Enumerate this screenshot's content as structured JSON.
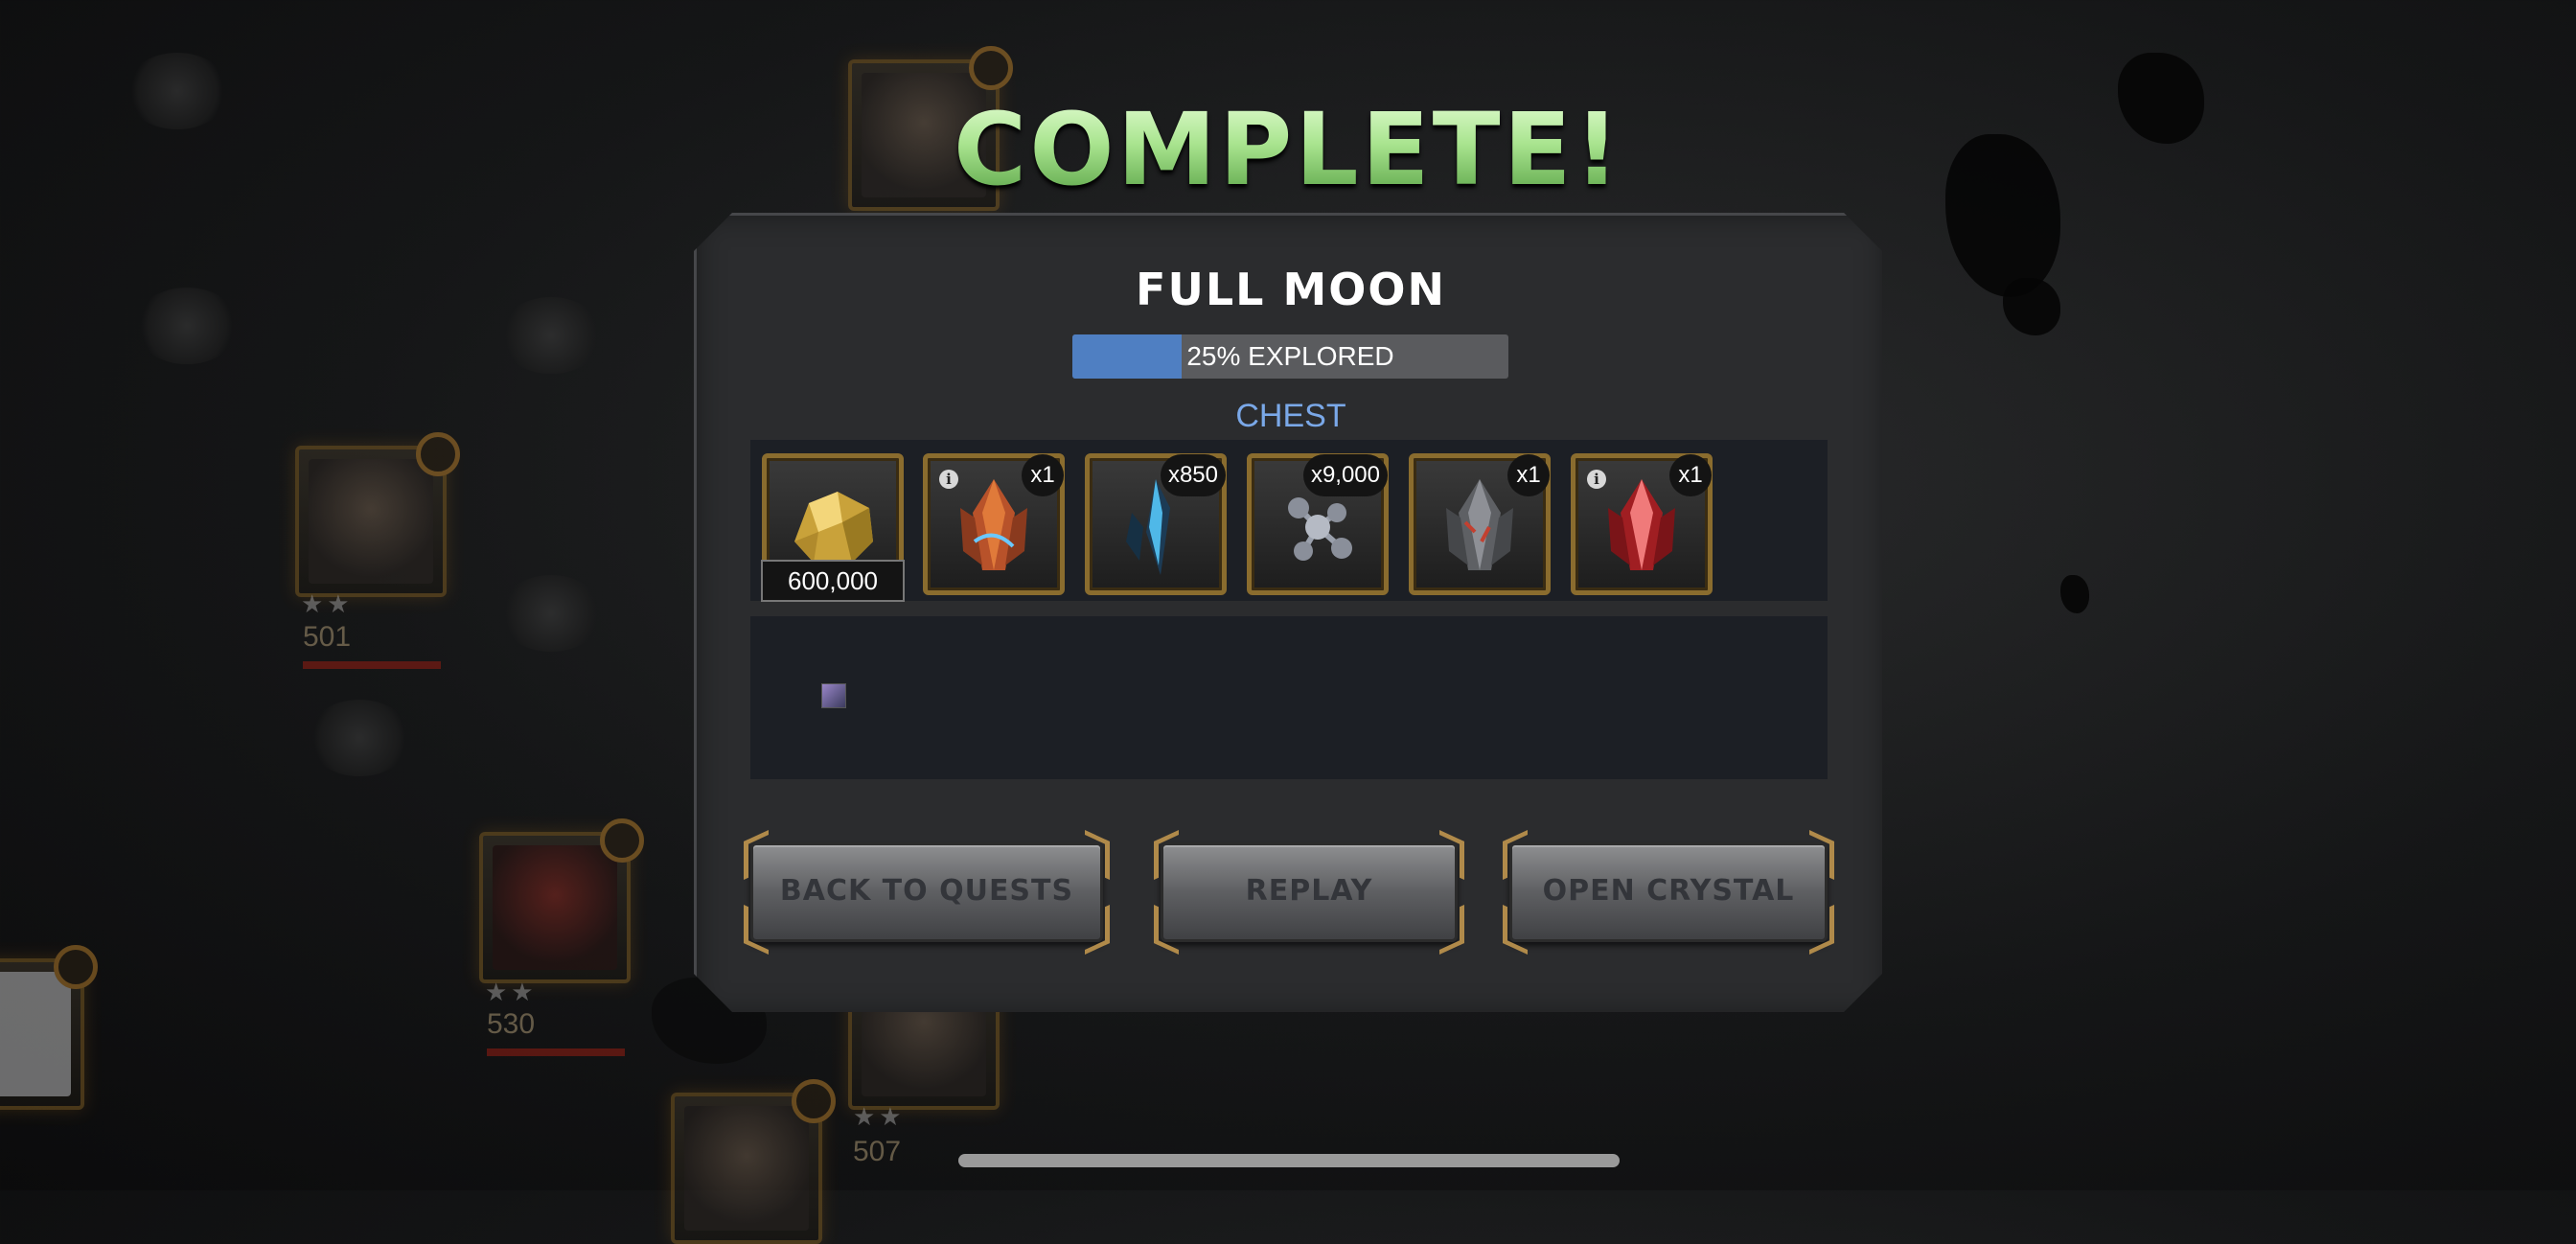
{
  "title": "COMPLETE!",
  "quest": {
    "name": "FULL MOON",
    "progress_percent": 25,
    "progress_label": "25% EXPLORED"
  },
  "chest": {
    "label": "CHEST",
    "rewards": [
      {
        "icon": "gold-icon",
        "amount": "600,000"
      },
      {
        "icon": "crystal-icon",
        "quantity": "x1",
        "has_info": true
      },
      {
        "icon": "shard-icon",
        "quantity": "x850"
      },
      {
        "icon": "iso8-icon",
        "quantity": "x9,000"
      },
      {
        "icon": "grey-crystal-icon",
        "quantity": "x1"
      },
      {
        "icon": "red-crystal-icon",
        "quantity": "x1",
        "has_info": true
      }
    ]
  },
  "background_map": {
    "champion_levels": [
      "501",
      "530",
      "507"
    ]
  },
  "buttons": {
    "back_to_quests": "BACK TO QUESTS",
    "replay": "REPLAY",
    "open_crystal": "OPEN CRYSTAL"
  },
  "info_glyph": "i",
  "colors": {
    "title_green": "#a9e48f",
    "progress_blue": "#4f7fc2",
    "chest_label_blue": "#7aa8e8",
    "button_gray": "#5e5f62",
    "frame_gold": "#8a6c2e"
  }
}
